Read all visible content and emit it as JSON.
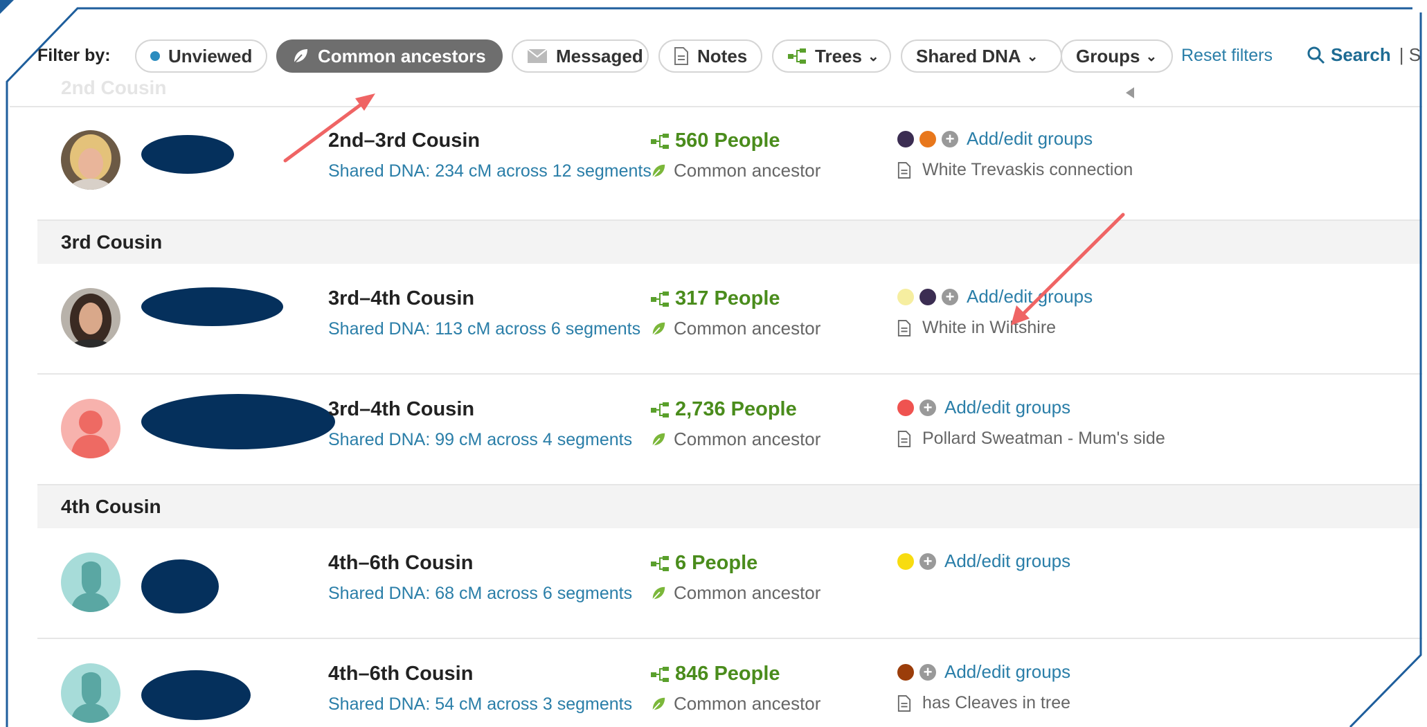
{
  "filter": {
    "label": "Filter by:",
    "ghost_heading": "2nd Cousin",
    "unviewed": "Unviewed",
    "common_ancestors": "Common ancestors",
    "messaged": "Messaged",
    "notes": "Notes",
    "trees": "Trees",
    "shared_dna": "Shared DNA",
    "groups": "Groups",
    "reset": "Reset filters",
    "search": "Search",
    "separator": "| S"
  },
  "sections": {
    "third": "3rd Cousin",
    "fourth": "4th Cousin"
  },
  "matches": [
    {
      "relationship": "2nd–3rd Cousin",
      "shared_dna": "Shared DNA: 234 cM across 12 segments",
      "people": "560 People",
      "ancestor": "Common ancestor",
      "groups_label": "Add/edit groups",
      "group_colors": [
        "#3b2d52",
        "#e8771c"
      ],
      "note": "White Trevaskis connection"
    },
    {
      "relationship": "3rd–4th Cousin",
      "shared_dna": "Shared DNA: 113 cM across 6 segments",
      "people": "317 People",
      "ancestor": "Common ancestor",
      "groups_label": "Add/edit groups",
      "group_colors": [
        "#f6eea0",
        "#3b2d52"
      ],
      "note": "White in Wiltshire"
    },
    {
      "relationship": "3rd–4th Cousin",
      "shared_dna": "Shared DNA: 99 cM across 4 segments",
      "people": "2,736 People",
      "ancestor": "Common ancestor",
      "groups_label": "Add/edit groups",
      "group_colors": [
        "#ef5350"
      ],
      "note": "Pollard Sweatman - Mum's side"
    },
    {
      "relationship": "4th–6th Cousin",
      "shared_dna": "Shared DNA: 68 cM across 6 segments",
      "people": "6 People",
      "ancestor": "Common ancestor",
      "groups_label": "Add/edit groups",
      "group_colors": [
        "#f8dc10"
      ],
      "note": ""
    },
    {
      "relationship": "4th–6th Cousin",
      "shared_dna": "Shared DNA: 54 cM across 3 segments",
      "people": "846 People",
      "ancestor": "Common ancestor",
      "groups_label": "Add/edit groups",
      "group_colors": [
        "#9b3d0a"
      ],
      "note": "has Cleaves in tree"
    }
  ],
  "colors": {
    "link": "#2a7ea8",
    "people_green": "#4a8c1c",
    "redaction": "#05305c",
    "annotation_arrow": "#ef6464",
    "active_pill": "#6e6e6e"
  },
  "icons": {
    "unviewed": "dot-icon",
    "common_ancestors": "leaf-icon",
    "messaged": "envelope-icon",
    "notes": "note-icon",
    "trees": "tree-icon",
    "search": "search-icon"
  }
}
